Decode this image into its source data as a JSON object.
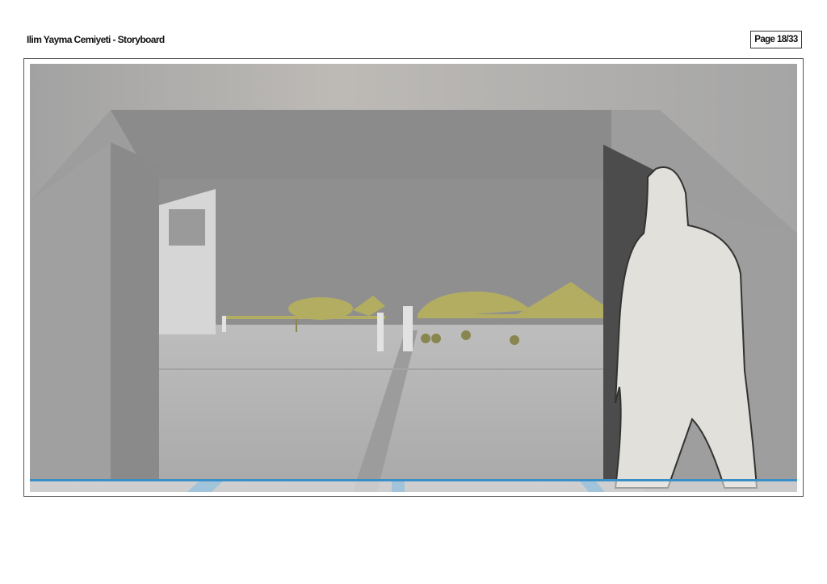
{
  "header": {
    "title": "Ilim Yayma Cemiyeti - Storyboard",
    "page_label": "Page 18/33"
  },
  "panel": {
    "subject": "storyboard-frame",
    "colors": {
      "drone": "#b3ad62",
      "marking": "#3a8fc8",
      "wall": "#8e8e8e"
    }
  }
}
